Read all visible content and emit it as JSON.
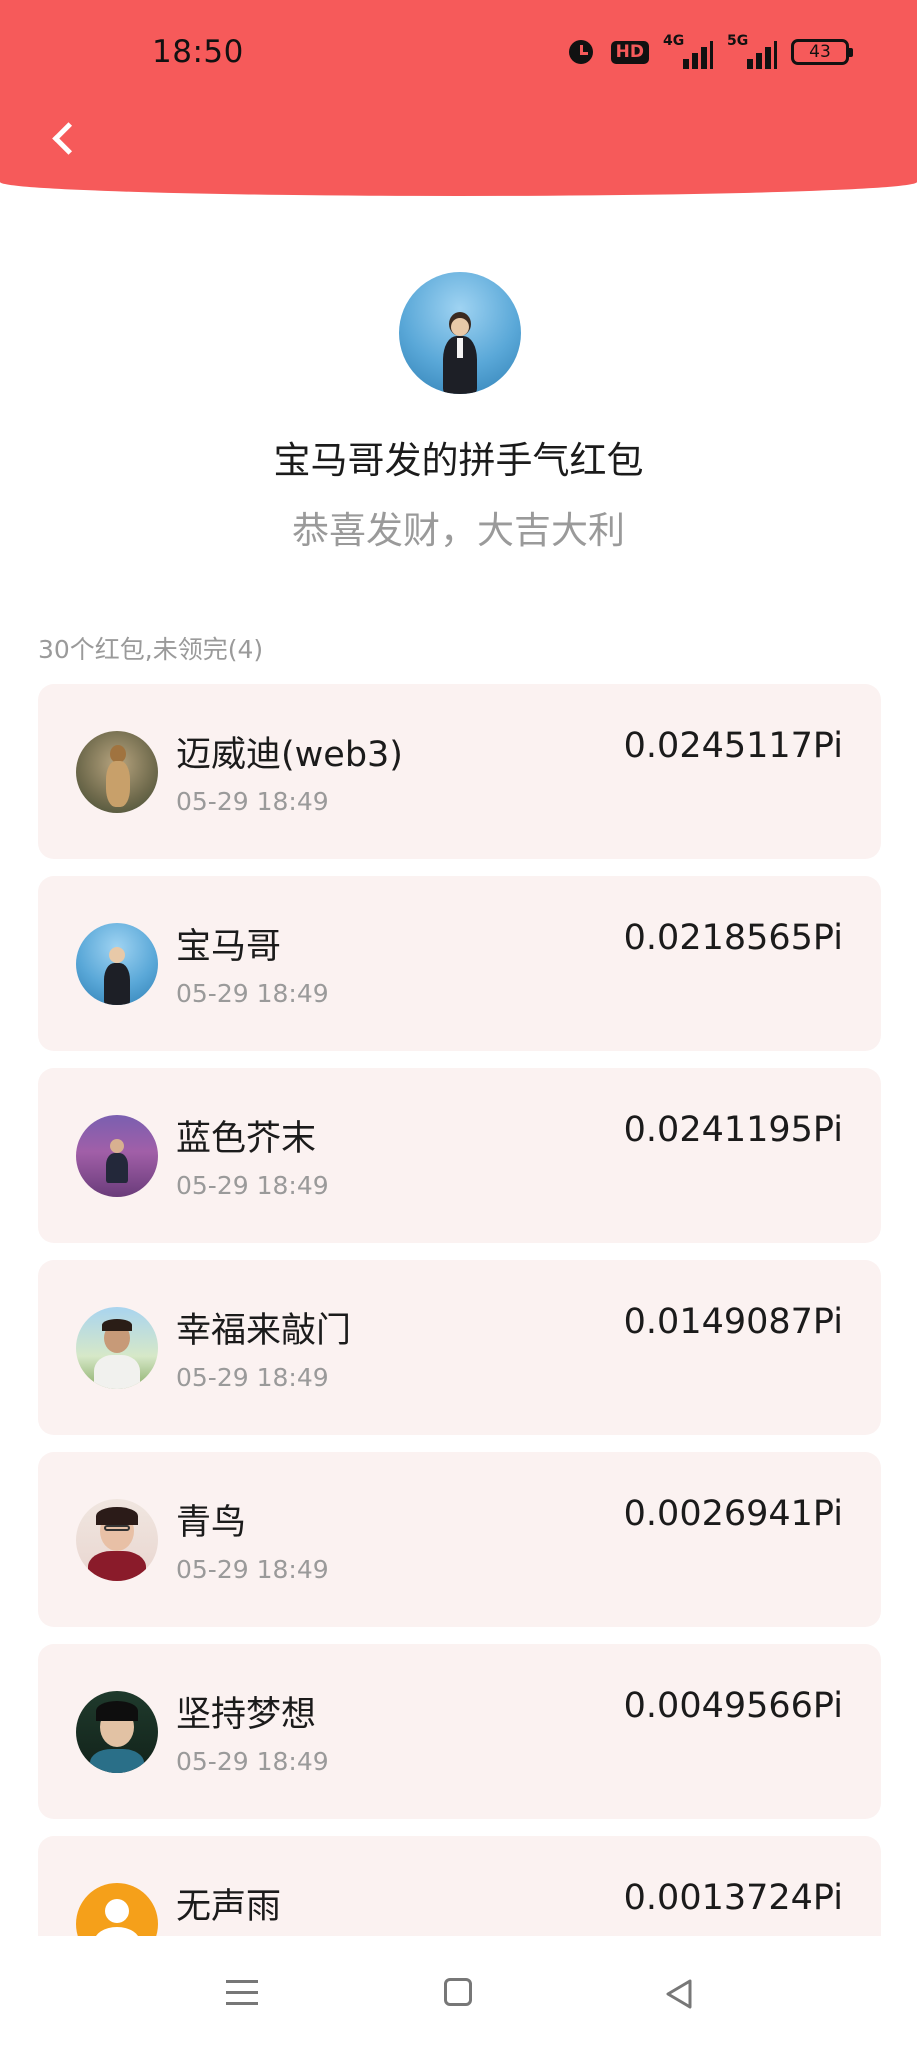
{
  "status_bar": {
    "time": "18:50",
    "hd_label": "HD",
    "network_1": "4G",
    "network_2": "5G",
    "battery": "43"
  },
  "header": {
    "back_icon": "chevron-left-icon"
  },
  "packet": {
    "title": "宝马哥发的拼手气红包",
    "subtitle": "恭喜发财，大吉大利",
    "summary": "30个红包,未领完(4)"
  },
  "records": [
    {
      "name": "迈威迪(web3)",
      "time": "05-29 18:49",
      "amount": "0.0245117Pi"
    },
    {
      "name": "宝马哥",
      "time": "05-29 18:49",
      "amount": "0.0218565Pi"
    },
    {
      "name": "蓝色芥末",
      "time": "05-29 18:49",
      "amount": "0.0241195Pi"
    },
    {
      "name": "幸福来敲门",
      "time": "05-29 18:49",
      "amount": "0.0149087Pi"
    },
    {
      "name": "青鸟",
      "time": "05-29 18:49",
      "amount": "0.0026941Pi"
    },
    {
      "name": "坚持梦想",
      "time": "05-29 18:49",
      "amount": "0.0049566Pi"
    },
    {
      "name": "无声雨",
      "time": "",
      "amount": "0.0013724Pi"
    }
  ],
  "colors": {
    "header": "#f65a5a",
    "card": "#fbf2f1",
    "muted_text": "#9a9a9a"
  }
}
